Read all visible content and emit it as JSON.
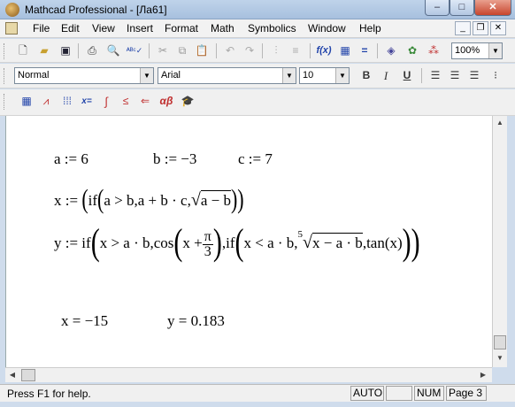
{
  "window": {
    "title": "Mathcad Professional - [Ла61]"
  },
  "menu": [
    "File",
    "Edit",
    "View",
    "Insert",
    "Format",
    "Math",
    "Symbolics",
    "Window",
    "Help"
  ],
  "toolbar": {
    "zoom": "100%"
  },
  "format_bar": {
    "style": "Normal",
    "font": "Arial",
    "size": "10",
    "bold": "B",
    "italic": "I",
    "underline": "U"
  },
  "document": {
    "line1": {
      "a": "a := 6",
      "b": "b := −3",
      "c": "c := 7"
    },
    "line2": {
      "lhs": "x := ",
      "if": "if",
      "cond": "a > b",
      "then": "a + b · c",
      "sqrt": "a − b"
    },
    "line3": {
      "lhs": "y := if",
      "cond1": "x > a · b",
      "cos": "cos",
      "x_plus": "x +",
      "pi": "π",
      "three": "3",
      "if2": "if",
      "cond2": "x < a · b",
      "root_index": "5",
      "root_body": "x − a · b",
      "tan": "tan(x)"
    },
    "results": {
      "x": "x = −15",
      "y": "y = 0.183"
    }
  },
  "status": {
    "help": "Press F1 for help.",
    "auto": "AUTO",
    "num": "NUM",
    "page": "Page 3"
  }
}
